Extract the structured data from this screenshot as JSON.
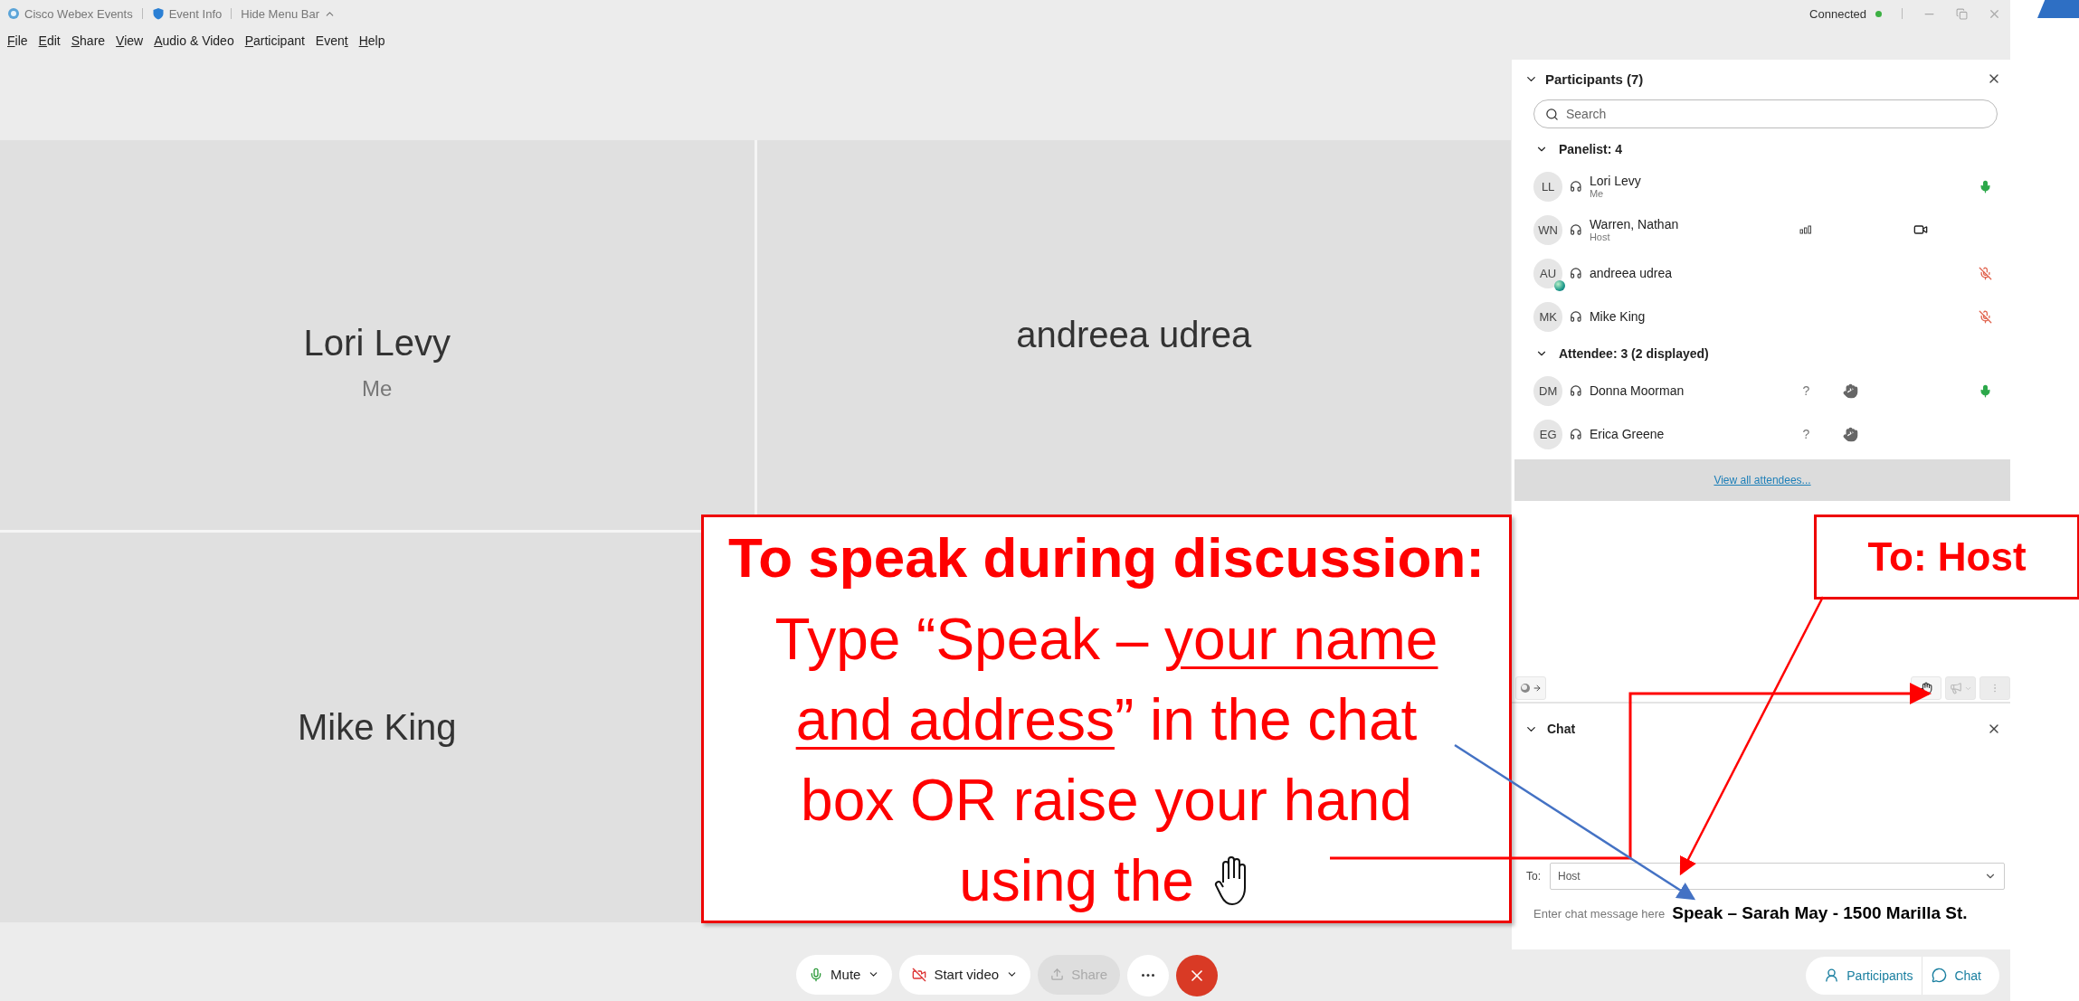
{
  "title_bar": {
    "app_name": "Cisco Webex Events",
    "event_info": "Event Info",
    "hide_menu": "Hide Menu Bar",
    "connection": "Connected",
    "connected": true
  },
  "menu": [
    {
      "key": "F",
      "post": "ile"
    },
    {
      "key": "E",
      "post": "dit"
    },
    {
      "key": "S",
      "post": "hare"
    },
    {
      "key": "V",
      "post": "iew"
    },
    {
      "key": "A",
      "post": "udio & Video"
    },
    {
      "key": "P",
      "post": "articipant"
    },
    {
      "pre": "Even",
      "key": "t"
    },
    {
      "key": "H",
      "post": "elp"
    }
  ],
  "video_tiles": [
    {
      "name": "Lori Levy",
      "subtitle": "Me"
    },
    {
      "name": "andreea udrea"
    },
    {
      "name": "Mike King"
    }
  ],
  "controls": [
    {
      "kind": "mute",
      "label": "Mute",
      "disabled": false
    },
    {
      "kind": "video",
      "label": "Start video",
      "disabled": false
    },
    {
      "kind": "share",
      "label": "Share",
      "disabled": true
    },
    {
      "kind": "more",
      "disabled": false
    },
    {
      "kind": "leave",
      "disabled": false
    }
  ],
  "participants": {
    "title": "Participants (7)",
    "expanded": true,
    "search_placeholder": "Search",
    "view_all": "View all attendees...",
    "groups": [
      {
        "label": "Panelist: 4",
        "expanded": true,
        "members": [
          {
            "initials": "LL",
            "name": "Lori Levy",
            "role": "Me",
            "mic_live": true,
            "mic_muted": false,
            "badge": false,
            "audio_bars": false,
            "video": false,
            "hand_raised": false
          },
          {
            "initials": "WN",
            "name": "Warren, Nathan",
            "role": "Host",
            "mic_live": false,
            "mic_muted": false,
            "badge": false,
            "audio_bars": true,
            "video": true,
            "hand_raised": false
          },
          {
            "initials": "AU",
            "name": "andreea udrea",
            "mic_live": false,
            "mic_muted": true,
            "badge": true,
            "audio_bars": false,
            "video": false,
            "hand_raised": false
          },
          {
            "initials": "MK",
            "name": "Mike King",
            "mic_live": false,
            "mic_muted": true,
            "badge": false,
            "audio_bars": false,
            "video": false,
            "hand_raised": false
          }
        ]
      },
      {
        "label": "Attendee: 3 (2 displayed)",
        "expanded": true,
        "members": [
          {
            "initials": "DM",
            "name": "Donna Moorman",
            "flag": "?",
            "mic_live": true,
            "mic_muted": false,
            "badge": false,
            "audio_bars": false,
            "video": false,
            "hand_raised": true
          },
          {
            "initials": "EG",
            "name": "Erica Greene",
            "flag": "?",
            "mic_live": false,
            "mic_muted": false,
            "badge": false,
            "audio_bars": false,
            "video": false,
            "hand_raised": true
          }
        ]
      }
    ]
  },
  "chat": {
    "title": "Chat",
    "expanded": true,
    "to_label": "To:",
    "recipient": "Host",
    "placeholder": "Enter chat message here"
  },
  "panel_tabs": [
    {
      "kind": "participants",
      "label": "Participants"
    },
    {
      "kind": "chat",
      "label": "Chat"
    }
  ],
  "annotations": {
    "instruction": {
      "title": "To speak during discussion:",
      "lines": [
        [
          {
            "text": "Type “Speak – ",
            "underline": false
          },
          {
            "text": "your name",
            "underline": true
          }
        ],
        [
          {
            "text": "and address",
            "underline": true
          },
          {
            "text": "” in the chat",
            "underline": false
          }
        ],
        [
          {
            "text": "box OR raise your hand",
            "underline": false
          }
        ],
        [
          {
            "text": "using the",
            "underline": false
          }
        ]
      ]
    },
    "recipient_note": "To: Host",
    "example_message": "Speak – Sarah May - 1500 Marilla St."
  }
}
